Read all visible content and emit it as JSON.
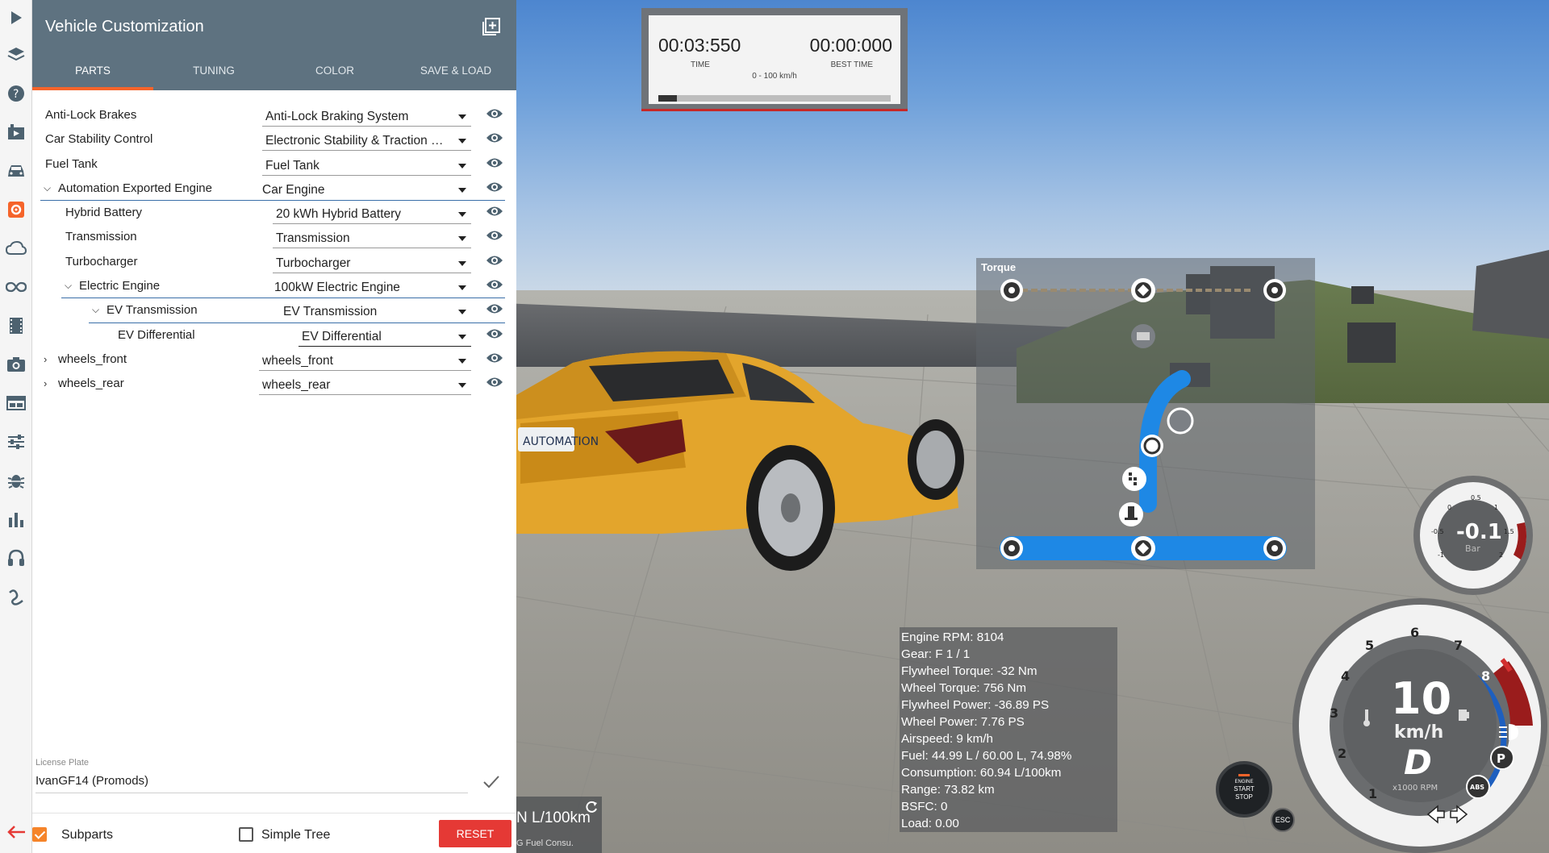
{
  "panel": {
    "title": "Vehicle Customization",
    "tabs": [
      "PARTS",
      "TUNING",
      "COLOR",
      "SAVE & LOAD"
    ],
    "active_tab": "PARTS",
    "parts": [
      {
        "label": "Anti-Lock Brakes",
        "value": "Anti-Lock Braking System"
      },
      {
        "label": "Car Stability Control",
        "value": "Electronic Stability & Traction C..."
      },
      {
        "label": "Fuel Tank",
        "value": "Fuel Tank"
      },
      {
        "label": "Automation Exported Engine",
        "value": "Car Engine"
      },
      {
        "label": "Hybrid Battery",
        "value": "20 kWh Hybrid Battery"
      },
      {
        "label": "Transmission",
        "value": "Transmission"
      },
      {
        "label": "Turbocharger",
        "value": "Turbocharger"
      },
      {
        "label": "Electric Engine",
        "value": "100kW Electric Engine"
      },
      {
        "label": "EV Transmission",
        "value": "EV Transmission"
      },
      {
        "label": "EV Differential",
        "value": "EV Differential"
      },
      {
        "label": "wheels_front",
        "value": "wheels_front"
      },
      {
        "label": "wheels_rear",
        "value": "wheels_rear"
      }
    ],
    "license_plate_label": "License Plate",
    "license_plate_value": "IvanGF14 (Promods)",
    "subparts_label": "Subparts",
    "subparts_checked": true,
    "simple_tree_label": "Simple Tree",
    "simple_tree_checked": false,
    "reset_label": "RESET",
    "accent_color": "#f5642a",
    "header_color": "#5e7280"
  },
  "timer": {
    "time": "00:03:550",
    "time_label": "TIME",
    "best": "00:00:000",
    "best_label": "BEST TIME",
    "range": "0 - 100 km/h",
    "progress": 0.08
  },
  "torque": {
    "title": "Torque"
  },
  "debug": [
    "Engine RPM: 8104",
    "Gear: F 1 / 1",
    "Flywheel Torque: -32 Nm",
    "Wheel Torque: 756 Nm",
    "Flywheel Power: -36.89 PS",
    "Wheel Power: 7.76 PS",
    "Airspeed: 9 km/h",
    "Fuel: 44.99 L / 60.00 L, 74.98%",
    "Consumption: 60.94 L/100km",
    "Range: 73.82 km",
    "BSFC: 0",
    "Load: 0.00"
  ],
  "fuel_widget": {
    "value": "N L/100km",
    "sub": "G Fuel Consu."
  },
  "boost_gauge": {
    "value": "-0.1",
    "unit": "Bar",
    "ticks": [
      "-1",
      "-0.5",
      "0",
      "0.5",
      "1",
      "1.5",
      "2"
    ]
  },
  "speedo": {
    "speed": "10",
    "unit": "km/h",
    "gear": "D",
    "rpm_label": "x1000 RPM",
    "rpm_ticks": [
      "1",
      "2",
      "3",
      "4",
      "5",
      "6",
      "7",
      "8"
    ],
    "park": "P",
    "abs": "ABS"
  },
  "engine_button": {
    "line1": "ENGINE",
    "line2": "START",
    "line3": "STOP"
  },
  "esc_label": "ESC",
  "car_badge": "AUTOMATION"
}
